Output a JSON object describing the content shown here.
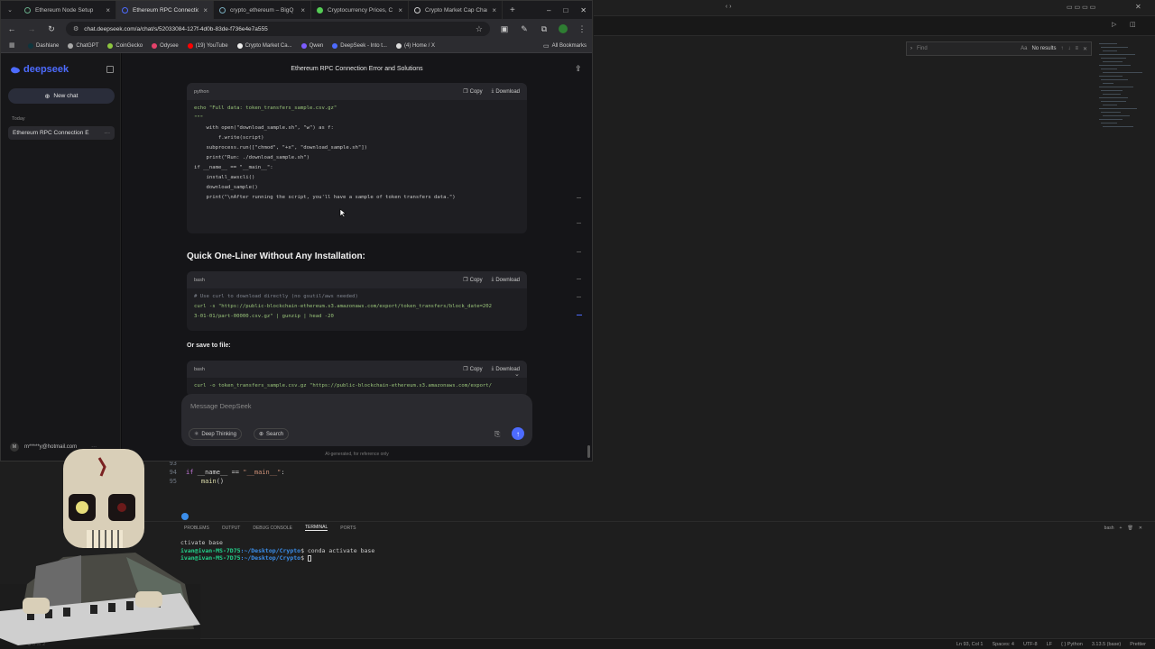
{
  "browser": {
    "tabs": [
      {
        "label": "Ethereum Node Setup"
      },
      {
        "label": "Ethereum RPC Connection"
      },
      {
        "label": "crypto_ethereum – BigQ"
      },
      {
        "label": "Cryptocurrency Prices, C"
      },
      {
        "label": "Crypto Market Cap Char"
      }
    ],
    "url": "chat.deepseek.com/a/chat/s/52033084-127f-4d0b-83de-f736e4e7a555",
    "bookmarks": [
      "Dashlane",
      "ChatGPT",
      "CoinGecko",
      "Odysee",
      "(19) YouTube",
      "Crypto Market Ca...",
      "Qwen",
      "DeepSeek - Into t...",
      "(4) Home / X"
    ],
    "all_bookmarks": "All Bookmarks"
  },
  "sidebar": {
    "brand": "deepseek",
    "new_chat": "New chat",
    "section_today": "Today",
    "chat_item": "Ethereum RPC Connection E",
    "user_initial": "M",
    "user_email": "m*****y@hotmail.com"
  },
  "chat": {
    "title": "Ethereum RPC Connection Error and Solutions",
    "copy_label": "Copy",
    "download_label": "Download",
    "block1": {
      "lang": "python",
      "lines": [
        "echo \"Full data: token_transfers_sample.csv.gz\"",
        "\"\"\"",
        "",
        "    with open(\"download_sample.sh\", \"w\") as f:",
        "        f.write(script)",
        "",
        "    subprocess.run([\"chmod\", \"+x\", \"download_sample.sh\"])",
        "    print(\"Run: ./download_sample.sh\")",
        "",
        "if __name__ == \"__main__\":",
        "    install_awscli()",
        "    download_sample()",
        "    print(\"\\nAfter running the script, you'll have a sample of token transfers data.\")"
      ]
    },
    "heading1": "Quick One-Liner Without Any Installation:",
    "block2": {
      "lang": "bash",
      "lines": [
        "# Use curl to download directly (no gsutil/aws needed)",
        "curl -s \"https://public-blockchain-ethereum.s3.amazonaws.com/export/token_transfers/block_date=202",
        "3-01-01/part-00000.csv.gz\" | gunzip | head -20"
      ]
    },
    "para1": "Or save to file:",
    "block3": {
      "lang": "bash",
      "lines": [
        "curl -o token_transfers_sample.csv.gz \"https://public-blockchain-ethereum.s3.amazonaws.com/export/"
      ]
    },
    "composer_placeholder": "Message DeepSeek",
    "deep_thinking": "Deep Thinking",
    "search": "Search",
    "disclaimer": "AI-generated, for reference only"
  },
  "vscode": {
    "find_placeholder": "Find",
    "find_aa": "Aa",
    "find_results": "No results",
    "code_lines": [
      {
        "num": "93",
        "text": ""
      },
      {
        "num": "94",
        "text": "if __name__ == \"__main__\":"
      },
      {
        "num": "95",
        "text": "    main()"
      }
    ],
    "panel_tabs": [
      "PROBLEMS",
      "OUTPUT",
      "DEBUG CONSOLE",
      "TERMINAL",
      "PORTS"
    ],
    "active_panel_tab": "TERMINAL",
    "terminal_shell": "bash",
    "terminal": {
      "line1": "ctivate base",
      "prompt": "ivan@ivan-MS-7D75",
      "path": ":~/Desktop/Crypto",
      "cmd1": "$ conda activate base",
      "cmd2": "$ "
    },
    "status_left": "⊗ 0 ⚠ 2",
    "status": [
      "Ln 93, Col 1",
      "Spaces: 4",
      "UTF-8",
      "LF",
      "{ } Python",
      "3.13.5 (base)",
      "Prettier"
    ]
  },
  "colors": {
    "accent": "#4d6bfe",
    "terminal_prompt": "#23d18b",
    "terminal_path": "#3b8eea"
  }
}
